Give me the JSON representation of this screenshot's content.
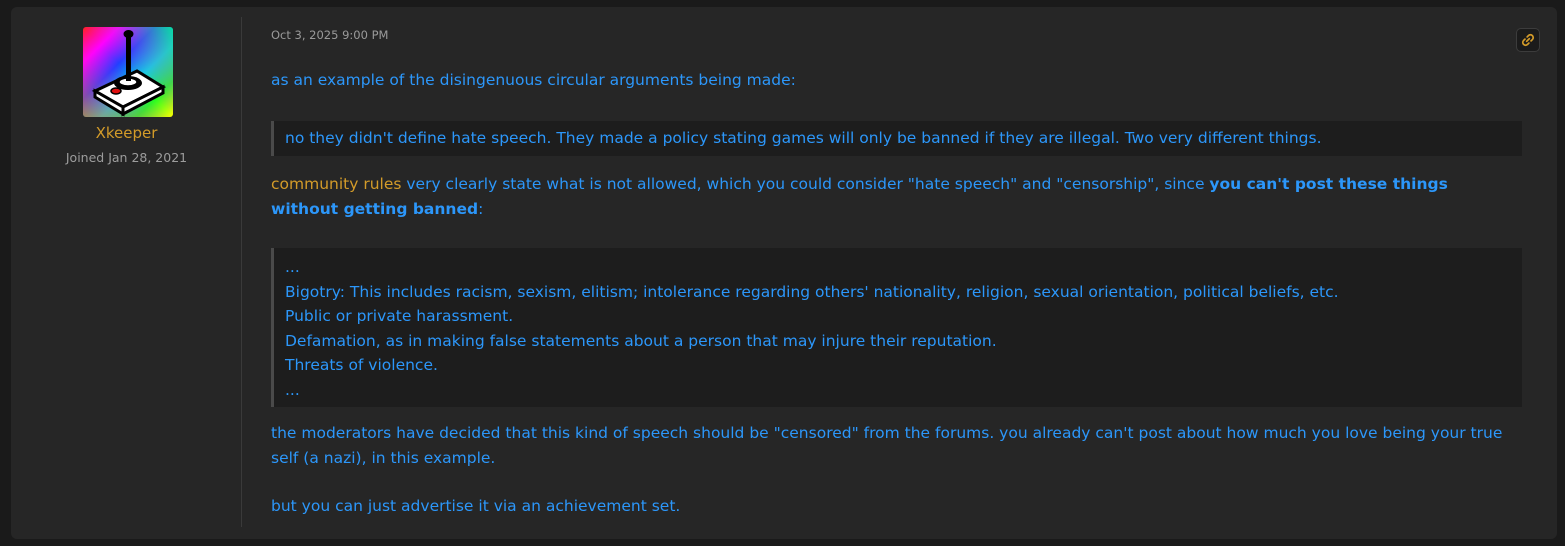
{
  "author": {
    "name": "Xkeeper",
    "joined": "Joined Jan 28, 2021",
    "avatar_icon": "joystick-icon"
  },
  "post": {
    "timestamp": "Oct 3, 2025 9:00 PM",
    "permalink_icon": "link-icon",
    "paragraph1": "as an example of the disingenuous circular arguments being made:",
    "quote1": "no they didn't define hate speech. They made a policy stating games will only be banned if they are illegal. Two very different things.",
    "paragraph2": {
      "link": "community rules",
      "text1": " very clearly state what is not allowed, which you could consider \"hate speech\" and \"censorship\", since ",
      "bold": "you can't post these things without getting banned",
      "text2": ":"
    },
    "quote2": [
      "...",
      "Bigotry: This includes racism, sexism, elitism; intolerance regarding others' nationality, religion, sexual orientation, political beliefs, etc.",
      "Public or private harassment.",
      "Defamation, as in making false statements about a person that may injure their reputation.",
      "Threats of violence.",
      "..."
    ],
    "paragraph3": "the moderators have decided that this kind of speech should be \"censored\" from the forums. you already can't post about how much you love being your true self (a nazi), in this example.",
    "paragraph4": "but you can just advertise it via an achievement set."
  },
  "colors": {
    "text": "#2c97fa",
    "accent": "#d39b29",
    "background": "#262626"
  }
}
